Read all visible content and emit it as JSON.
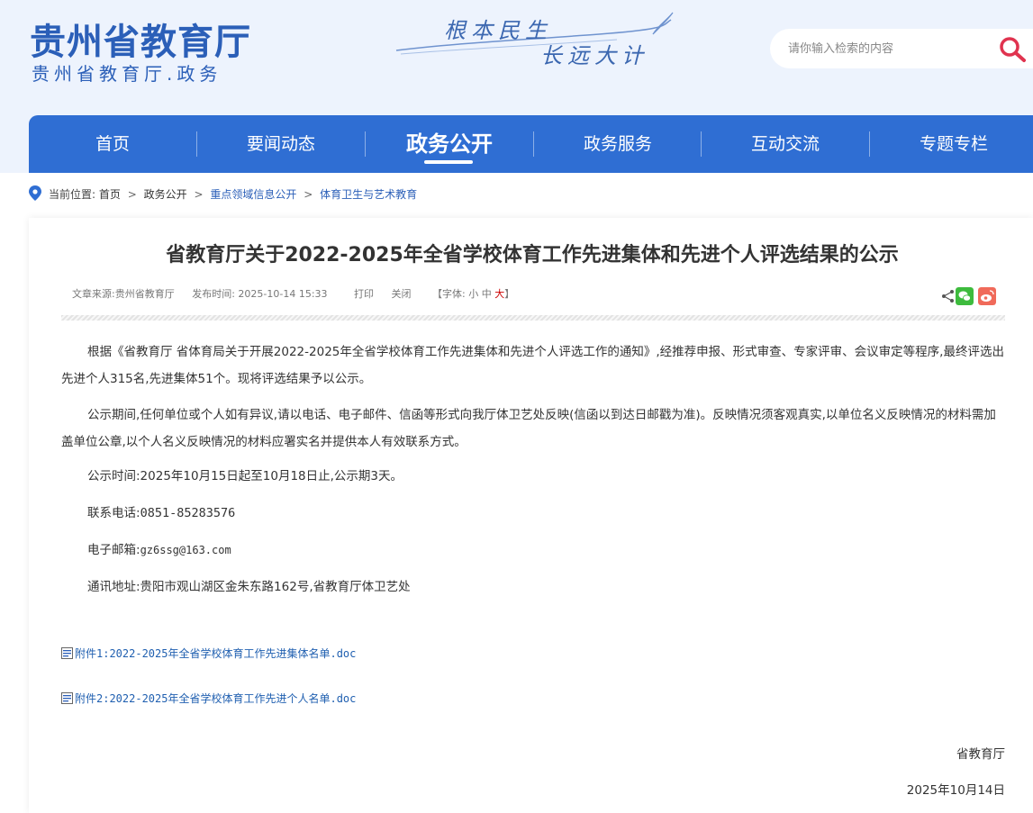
{
  "header": {
    "logo_main": "贵州省教育厅",
    "logo_sub": "贵州省教育厅.政务",
    "slogan_line1": "根本民生",
    "slogan_line2": "长远大计",
    "search_placeholder": "请你输入检索的内容"
  },
  "nav": {
    "items": [
      {
        "label": "首页"
      },
      {
        "label": "要闻动态"
      },
      {
        "label": "政务公开"
      },
      {
        "label": "政务服务"
      },
      {
        "label": "互动交流"
      },
      {
        "label": "专题专栏"
      }
    ],
    "active": "政务公开"
  },
  "breadcrumb": {
    "prefix": "当前位置:",
    "items": [
      "首页",
      "政务公开",
      "重点领域信息公开",
      "体育卫生与艺术教育"
    ],
    "separator": ">"
  },
  "article": {
    "title": "省教育厅关于2022-2025年全省学校体育工作先进集体和先进个人评选结果的公示",
    "source": "文章来源:贵州省教育厅",
    "publish_time": "发布时间: 2025-10-14 15:33",
    "print": "打印",
    "close": "关闭",
    "font_label": "【字体:",
    "font_small": "小",
    "font_medium": "中",
    "font_large": "大",
    "font_end": "】",
    "paragraphs": [
      "根据《省教育厅 省体育局关于开展2022-2025年全省学校体育工作先进集体和先进个人评选工作的通知》,经推荐申报、形式审查、专家评审、会议审定等程序,最终评选出先进个人315名,先进集体51个。现将评选结果予以公示。",
      "公示期间,任何单位或个人如有异议,请以电话、电子邮件、信函等形式向我厅体卫艺处反映(信函以到达日邮戳为准)。反映情况须客观真实,以单位名义反映情况的材料需加盖单位公章,以个人名义反映情况的材料应署实名并提供本人有效联系方式。",
      "公示时间:2025年10月15日起至10月18日止,公示期3天。"
    ],
    "phone_label": "联系电话:",
    "phone": "0851-85283576",
    "email_label": "电子邮箱:",
    "email": "gz6ssg@163.com",
    "address": "通讯地址:贵阳市观山湖区金朱东路162号,省教育厅体卫艺处",
    "attachments": [
      {
        "label": "附件1:2022-2025年全省学校体育工作先进集体名单.doc"
      },
      {
        "label": "附件2:2022-2025年全省学校体育工作先进个人名单.doc"
      }
    ],
    "signature": "省教育厅",
    "date": "2025年10月14日"
  },
  "colors": {
    "brand_blue": "#2f6ed3",
    "logo_blue": "#2b5fb8",
    "header_bg": "#edf3fd",
    "search_icon_red": "#e0334f",
    "link_blue": "#1f5fb0"
  }
}
